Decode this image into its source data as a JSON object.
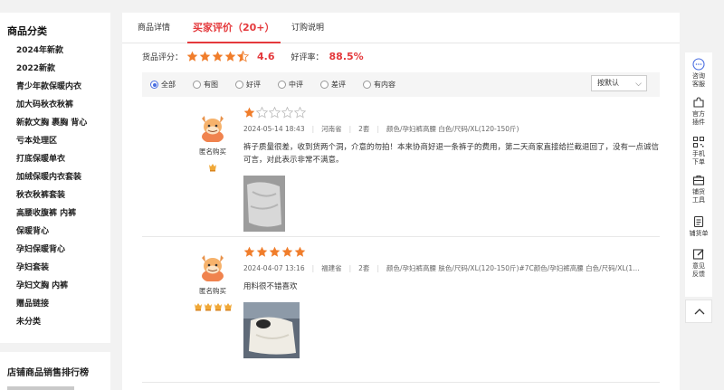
{
  "sidebar": {
    "title": "商品分类",
    "items": [
      "2024年新款",
      "2022新款",
      "青少年款保暖内衣",
      "加大码秋衣秋裤",
      "新款文胸 裹胸 背心",
      "亏本处理区",
      "打底保暖单衣",
      "加绒保暖内衣套装",
      "秋衣秋裤套装",
      "高腰收腹裤 内裤",
      "保暖背心",
      "孕妇保暖背心",
      "孕妇套装",
      "孕妇文胸 内裤",
      "赠品链接",
      "未分类"
    ],
    "rank_title": "店铺商品销售排行榜"
  },
  "tabs": [
    "商品详情",
    "买家评价（20+）",
    "订购说明"
  ],
  "active_tab": 1,
  "score": {
    "label": "货品评分：",
    "stars": 4.5,
    "value": "4.6",
    "rate_label": "好评率：",
    "rate_value": "88.5%"
  },
  "filters": {
    "options": [
      "全部",
      "有图",
      "好评",
      "中评",
      "差评",
      "有内容"
    ],
    "selected": 0,
    "sort_label": "按默认"
  },
  "reviews": [
    {
      "user": "匿名购买",
      "badges": 1,
      "rating": 1,
      "date": "2024-05-14 18:43",
      "region": "河南省",
      "qty": "2套",
      "spec": "颜色/孕妇裤高腰 白色/尺码/XL(120-150斤)",
      "text": "裤子质量很差，收到货两个洞，介意的勿拍！本来协商好退一条裤子的费用，第二天商家直接给拦截退回了，没有一点诚信可言，对此表示非常不满意。",
      "photos": 1
    },
    {
      "user": "匿名购买",
      "badges": 4,
      "rating": 5,
      "date": "2024-04-07 13:16",
      "region": "福建省",
      "qty": "2套",
      "spec": "颜色/孕妇裤高腰 肤色/尺码/XL(120-150斤)#7C颜色/孕妇裤高腰 白色/尺码/XL(120-150...",
      "text": "用料很不错喜欢",
      "photos": 1
    }
  ],
  "toolbar": [
    {
      "label": "咨询\n客服",
      "icon": "chat-icon"
    },
    {
      "label": "官方\n插件",
      "icon": "puzzle-icon"
    },
    {
      "label": "手机\n下单",
      "icon": "qrcode-icon"
    },
    {
      "label": "铺货\n工具",
      "icon": "briefcase-icon"
    },
    {
      "label": "铺货单",
      "icon": "list-icon"
    },
    {
      "label": "意见\n反馈",
      "icon": "edit-icon"
    }
  ],
  "colors": {
    "accent": "#e4393c",
    "star": "#f07d2b",
    "radio": "#4a6ee0"
  }
}
